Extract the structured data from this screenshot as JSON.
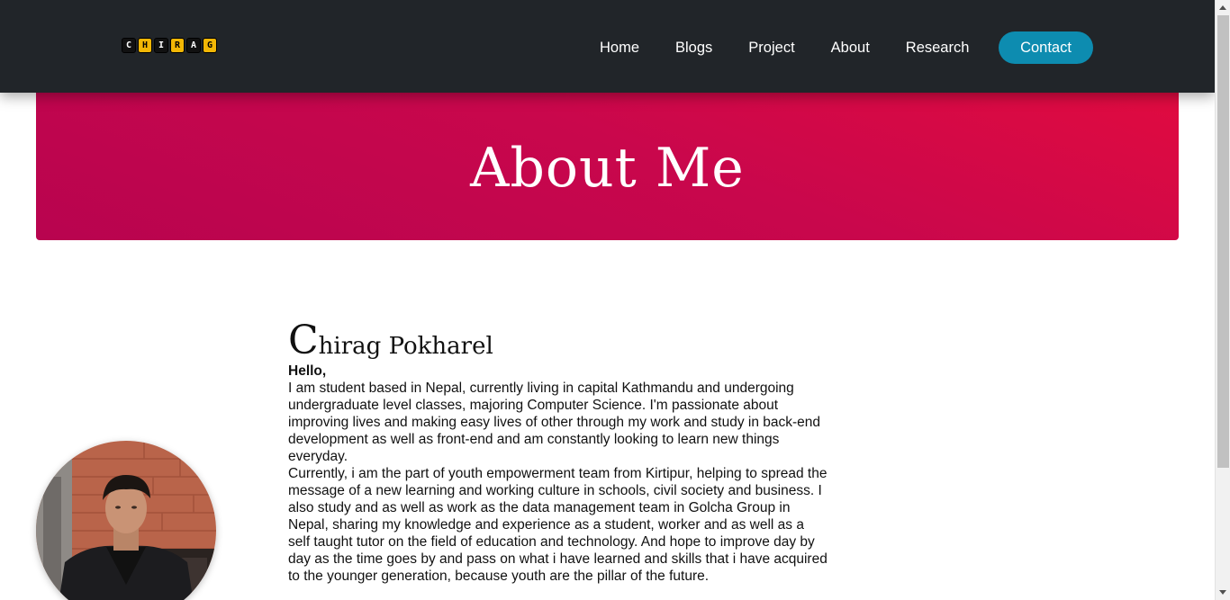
{
  "logo": {
    "letters": [
      "C",
      "H",
      "I",
      "R",
      "A",
      "G"
    ]
  },
  "nav": {
    "links": [
      "Home",
      "Blogs",
      "Project",
      "About",
      "Research"
    ],
    "contact_label": "Contact"
  },
  "hero": {
    "title": "About Me"
  },
  "profile": {
    "initial": "C",
    "name_rest": "hirag Pokharel",
    "greeting": "Hello,",
    "paragraph1": "I am student based in Nepal, currently living in capital Kathmandu and undergoing undergraduate level classes, majoring Computer Science. I'm passionate about improving lives and making easy lives of other through my work and study in back-end development as well as front-end and am constantly looking to learn new things everyday.",
    "paragraph2": "Currently, i am the part of youth empowerment team from Kirtipur, helping to spread the message of a new learning and working culture in schools, civil society and business. I also study and as well as work as the data management team in Golcha Group in Nepal, sharing my knowledge and experience as a student, worker and as well as a self taught tutor on the field of education and technology. And hope to improve day by day as the time goes by and pass on what i have learned and skills that i have acquired to the younger generation, because youth are the pillar of the future."
  },
  "colors": {
    "navbar": "#212529",
    "hero_start": "#e00b40",
    "hero_end": "#b8044f",
    "contact_button": "#0d8cb0",
    "logo_gold": "#f2b705"
  }
}
